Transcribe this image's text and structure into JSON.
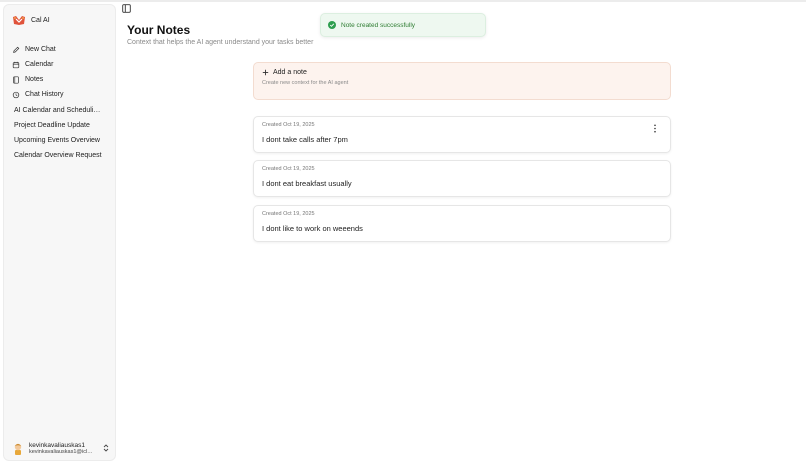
{
  "app": {
    "name": "Cal AI"
  },
  "sidebar": {
    "nav": [
      {
        "label": "New Chat",
        "icon": "pencil-icon"
      },
      {
        "label": "Calendar",
        "icon": "calendar-icon"
      },
      {
        "label": "Notes",
        "icon": "notebook-icon"
      },
      {
        "label": "Chat History",
        "icon": "history-icon"
      }
    ],
    "history": [
      "AI Calendar and Scheduli…",
      "Project Deadline Update",
      "Upcoming Events Overview",
      "Calendar Overview Request"
    ],
    "user": {
      "name": "kevinkavaliauskas1",
      "email": "kevinkavaliauskas1@icl…"
    }
  },
  "toast": {
    "message": "Note created successfully",
    "color": "#2e9e4f"
  },
  "page": {
    "title": "Your Notes",
    "subtitle": "Context that helps the AI agent understand your tasks better"
  },
  "add_note": {
    "title": "Add a note",
    "subtitle": "Create new context for the AI agent"
  },
  "notes": [
    {
      "date": "Created Oct 19, 2025",
      "text": "I dont take calls after 7pm"
    },
    {
      "date": "Created Oct 19, 2025",
      "text": "I dont eat breakfast usually"
    },
    {
      "date": "Created Oct 19, 2025",
      "text": "I dont like to work on weeends"
    }
  ],
  "colors": {
    "brand": "#e0533b",
    "accent_card": "#fdf3ee",
    "success": "#2e9e4f"
  }
}
